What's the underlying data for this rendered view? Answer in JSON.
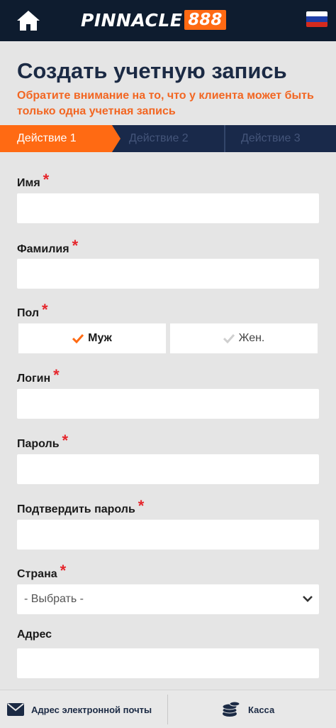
{
  "header": {
    "logo_text": "PINNACLE",
    "logo_number": "888",
    "home_icon": "home-icon",
    "flag_icon": "russia-flag-icon"
  },
  "page": {
    "title": "Создать учетную запись",
    "notice": "Обратите внимание на то, что у клиента может быть только одна учетная запись"
  },
  "steps": [
    "Действие 1",
    "Действие 2",
    "Действие 3"
  ],
  "form": {
    "required_mark": "*",
    "first_name": {
      "label": "Имя",
      "value": ""
    },
    "last_name": {
      "label": "Фамилия",
      "value": ""
    },
    "gender": {
      "label": "Пол",
      "male": "Муж",
      "female": "Жен.",
      "selected": "male"
    },
    "login": {
      "label": "Логин",
      "value": ""
    },
    "password": {
      "label": "Пароль",
      "value": ""
    },
    "confirm_password": {
      "label": "Подтвердить пароль",
      "value": ""
    },
    "country": {
      "label": "Страна",
      "selected": "- Выбрать -"
    },
    "address": {
      "label": "Адрес",
      "value": ""
    }
  },
  "bottom_bar": {
    "email_label": "Адрес электронной почты",
    "cashier_label": "Касса"
  },
  "colors": {
    "brand_orange": "#ff6a13",
    "navy": "#0e1c2f",
    "required_red": "#e5262c"
  }
}
